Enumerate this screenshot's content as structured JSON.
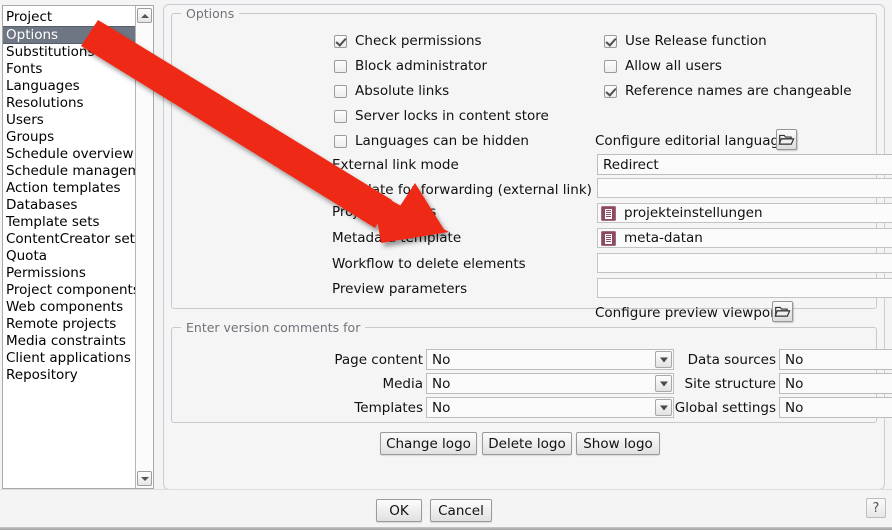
{
  "sidebar": {
    "items": [
      {
        "label": "Project",
        "selected": false
      },
      {
        "label": "Options",
        "selected": true
      },
      {
        "label": "Substitutions",
        "selected": false
      },
      {
        "label": "Fonts",
        "selected": false
      },
      {
        "label": "Languages",
        "selected": false
      },
      {
        "label": "Resolutions",
        "selected": false
      },
      {
        "label": "Users",
        "selected": false
      },
      {
        "label": "Groups",
        "selected": false
      },
      {
        "label": "Schedule overview",
        "selected": false
      },
      {
        "label": "Schedule management",
        "selected": false
      },
      {
        "label": "Action templates",
        "selected": false
      },
      {
        "label": "Databases",
        "selected": false
      },
      {
        "label": "Template sets",
        "selected": false
      },
      {
        "label": "ContentCreator settings",
        "selected": false
      },
      {
        "label": "Quota",
        "selected": false
      },
      {
        "label": "Permissions",
        "selected": false
      },
      {
        "label": "Project components",
        "selected": false
      },
      {
        "label": "Web components",
        "selected": false
      },
      {
        "label": "Remote projects",
        "selected": false
      },
      {
        "label": "Media constraints",
        "selected": false
      },
      {
        "label": "Client applications",
        "selected": false
      },
      {
        "label": "Repository",
        "selected": false
      }
    ],
    "scroll_up_icon": "triangle-up-icon",
    "scroll_down_icon": "triangle-down-icon"
  },
  "options_group": {
    "legend": "Options",
    "checkboxes_left": [
      {
        "label": "Check permissions",
        "checked": true
      },
      {
        "label": "Block administrator",
        "checked": false
      },
      {
        "label": "Absolute links",
        "checked": false
      },
      {
        "label": "Server locks in content store",
        "checked": false
      },
      {
        "label": "Languages can be hidden",
        "checked": false
      }
    ],
    "checkboxes_right": [
      {
        "label": "Use Release function",
        "checked": true
      },
      {
        "label": "Allow all users",
        "checked": false
      },
      {
        "label": "Reference names are changeable",
        "checked": true
      }
    ],
    "configure_editorial_languages": {
      "label": "Configure editorial languages",
      "button_icon": "folder-open-icon"
    },
    "configure_preview_viewports": {
      "label": "Configure preview viewports",
      "button_icon": "folder-open-icon"
    },
    "fields": [
      {
        "label": "External link mode",
        "type": "combo",
        "value": "Redirect",
        "arrow_icon": "chevron-down-icon",
        "has_browse": false,
        "has_clear": false,
        "icon": null
      },
      {
        "label": "Template for forwarding (external link) pages",
        "type": "text",
        "value": "",
        "has_browse": true,
        "has_clear": true,
        "icon": null
      },
      {
        "label": "Project settings",
        "type": "text",
        "value": "projekteinstellungen",
        "has_browse": true,
        "has_clear": true,
        "icon": "document-icon"
      },
      {
        "label": "Metadata template",
        "type": "text",
        "value": "meta-datan",
        "has_browse": true,
        "has_clear": true,
        "icon": "document-icon"
      },
      {
        "label": "Workflow to delete elements",
        "type": "text",
        "value": "",
        "has_browse": true,
        "has_clear": true,
        "icon": null
      },
      {
        "label": "Preview parameters",
        "type": "text",
        "value": "",
        "has_browse": true,
        "has_clear": true,
        "icon": null
      }
    ],
    "browse_icon": "folder-open-icon",
    "clear_icon": "close-x-icon"
  },
  "version_group": {
    "legend": "Enter version comments for",
    "rows_left": [
      {
        "label": "Page content",
        "value": "No"
      },
      {
        "label": "Media",
        "value": "No"
      },
      {
        "label": "Templates",
        "value": "No"
      }
    ],
    "rows_right": [
      {
        "label": "Data sources",
        "value": "No"
      },
      {
        "label": "Site structure",
        "value": "No"
      },
      {
        "label": "Global settings",
        "value": "No"
      }
    ],
    "arrow_icon": "chevron-down-icon"
  },
  "logo_buttons": [
    {
      "label": "Change logo"
    },
    {
      "label": "Delete logo"
    },
    {
      "label": "Show logo"
    }
  ],
  "footer": {
    "ok_label": "OK",
    "cancel_label": "Cancel",
    "help_label": "?"
  },
  "annotation": {
    "arrow_color": "#ee2b18",
    "arrow_name": "red-pointer-arrow"
  }
}
